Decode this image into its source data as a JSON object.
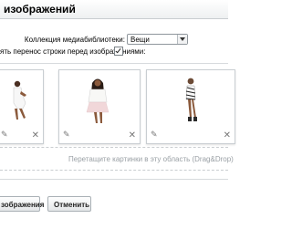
{
  "dialog": {
    "title": "изображений"
  },
  "settings": {
    "collection_label": "Коллекция медиабиблиотеки:",
    "collection_value": "Вещи",
    "line_break_label": "ять перенос строки перед изображениями:",
    "line_break_checked": true
  },
  "gallery": {
    "items": [
      {
        "id": "item-1",
        "alt": "",
        "icons": {
          "edit": "pencil-icon",
          "delete": "close-icon"
        }
      },
      {
        "id": "item-2",
        "alt": "",
        "icons": {
          "edit": "pencil-icon",
          "delete": "close-icon"
        }
      },
      {
        "id": "item-3",
        "alt": "",
        "icons": {
          "edit": "pencil-icon",
          "delete": "close-icon"
        }
      }
    ],
    "dropzone_text": "Перетащите картинки в эту область (Drag&Drop)"
  },
  "footer": {
    "save_label": "зображения",
    "cancel_label": "Отменить"
  }
}
